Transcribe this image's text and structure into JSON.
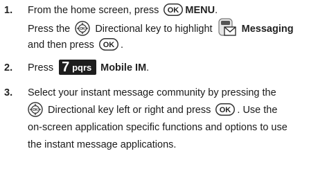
{
  "steps": [
    {
      "num": "1.",
      "l1_text": "From the home screen, press",
      "l1_menu": "MENU",
      "l1_end": ".",
      "l2_text": "Press the",
      "l2_after": "Directional key to highlight",
      "l2_target": "Messaging",
      "l3_text": "and then press",
      "l3_end": "."
    },
    {
      "num": "2.",
      "text": "Press",
      "key_digit": "7",
      "key_letters": "pqrs",
      "target": "Mobile IM",
      "end": "."
    },
    {
      "num": "3.",
      "l1": "Select your instant message community by pressing the",
      "l2_after": "Directional key left or right and press",
      "l2_end": ". Use the",
      "l3": "on-screen application specific functions and options to use",
      "l4": "the instant message applications."
    }
  ],
  "icons": {
    "ok_key_label": "OK",
    "ok_key": "ok-key-icon",
    "nav_key": "directional-key-icon",
    "messaging": "messaging-envelope-icon"
  }
}
